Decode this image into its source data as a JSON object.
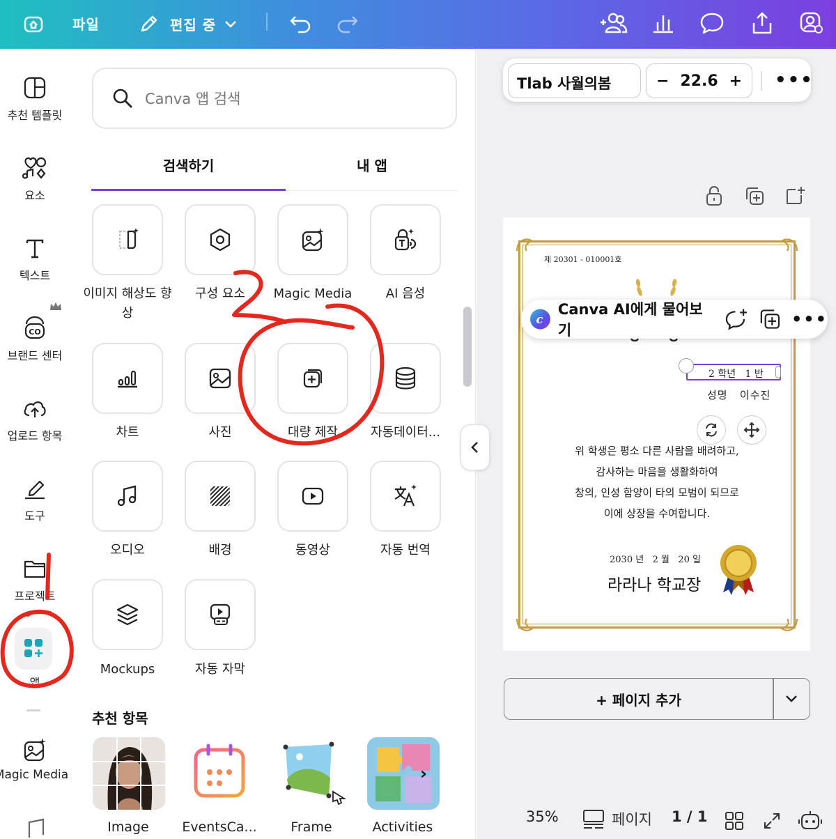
{
  "topbar": {
    "file_label": "파일",
    "edit_label": "편집 중"
  },
  "rail": {
    "items": [
      {
        "label": "추천 템플릿"
      },
      {
        "label": "요소"
      },
      {
        "label": "텍스트"
      },
      {
        "label": "브랜드 센터"
      },
      {
        "label": "업로드 항목"
      },
      {
        "label": "도구"
      },
      {
        "label": "프로젝트"
      },
      {
        "label": "앱"
      },
      {
        "label": "Magic Media"
      }
    ]
  },
  "panel": {
    "search_placeholder": "Canva 앱 검색",
    "tabs": [
      {
        "label": "검색하기"
      },
      {
        "label": "내 앱"
      }
    ],
    "apps": [
      {
        "label": "이미지 해상도 향상"
      },
      {
        "label": "구성 요소"
      },
      {
        "label": "Magic Media"
      },
      {
        "label": "AI 음성"
      },
      {
        "label": "차트"
      },
      {
        "label": "사진"
      },
      {
        "label": "대량 제작"
      },
      {
        "label": "자동데이터..."
      },
      {
        "label": "오디오"
      },
      {
        "label": "배경"
      },
      {
        "label": "동영상"
      },
      {
        "label": "자동 번역"
      },
      {
        "label": "Mockups"
      },
      {
        "label": "자동 자막"
      }
    ],
    "recommended_title": "추천 항목",
    "recommended": [
      {
        "label": "Image"
      },
      {
        "label": "EventsCa..."
      },
      {
        "label": "Frame"
      },
      {
        "label": "Activities"
      }
    ]
  },
  "editor": {
    "font_name": "Tlab 사월의봄",
    "font_size": "22.6",
    "ai_prompt": "Canva AI에게 물어보기",
    "add_page": "+ 페이지 추가",
    "zoom": "35%",
    "pages_label": "페이지",
    "page_count": "1 / 1"
  },
  "certificate": {
    "number": "제 20301 - 010001호",
    "grade_line": "2 학년   1 반",
    "name_line": "성명   이수진",
    "body": [
      "위 학생은 평소 다른 사람을 배려하고,",
      "감사하는 마음을 생활화하여",
      "창의, 인성 함양이 타의 모범이 되므로",
      "이에 상장을 수여합니다."
    ],
    "date": "2030 년   2 월   20 일",
    "signer": "라라나 학교장"
  },
  "colors": {
    "accent": "#7b3fe0",
    "gold": "#c49a3c",
    "annotation": "#e5281e"
  }
}
